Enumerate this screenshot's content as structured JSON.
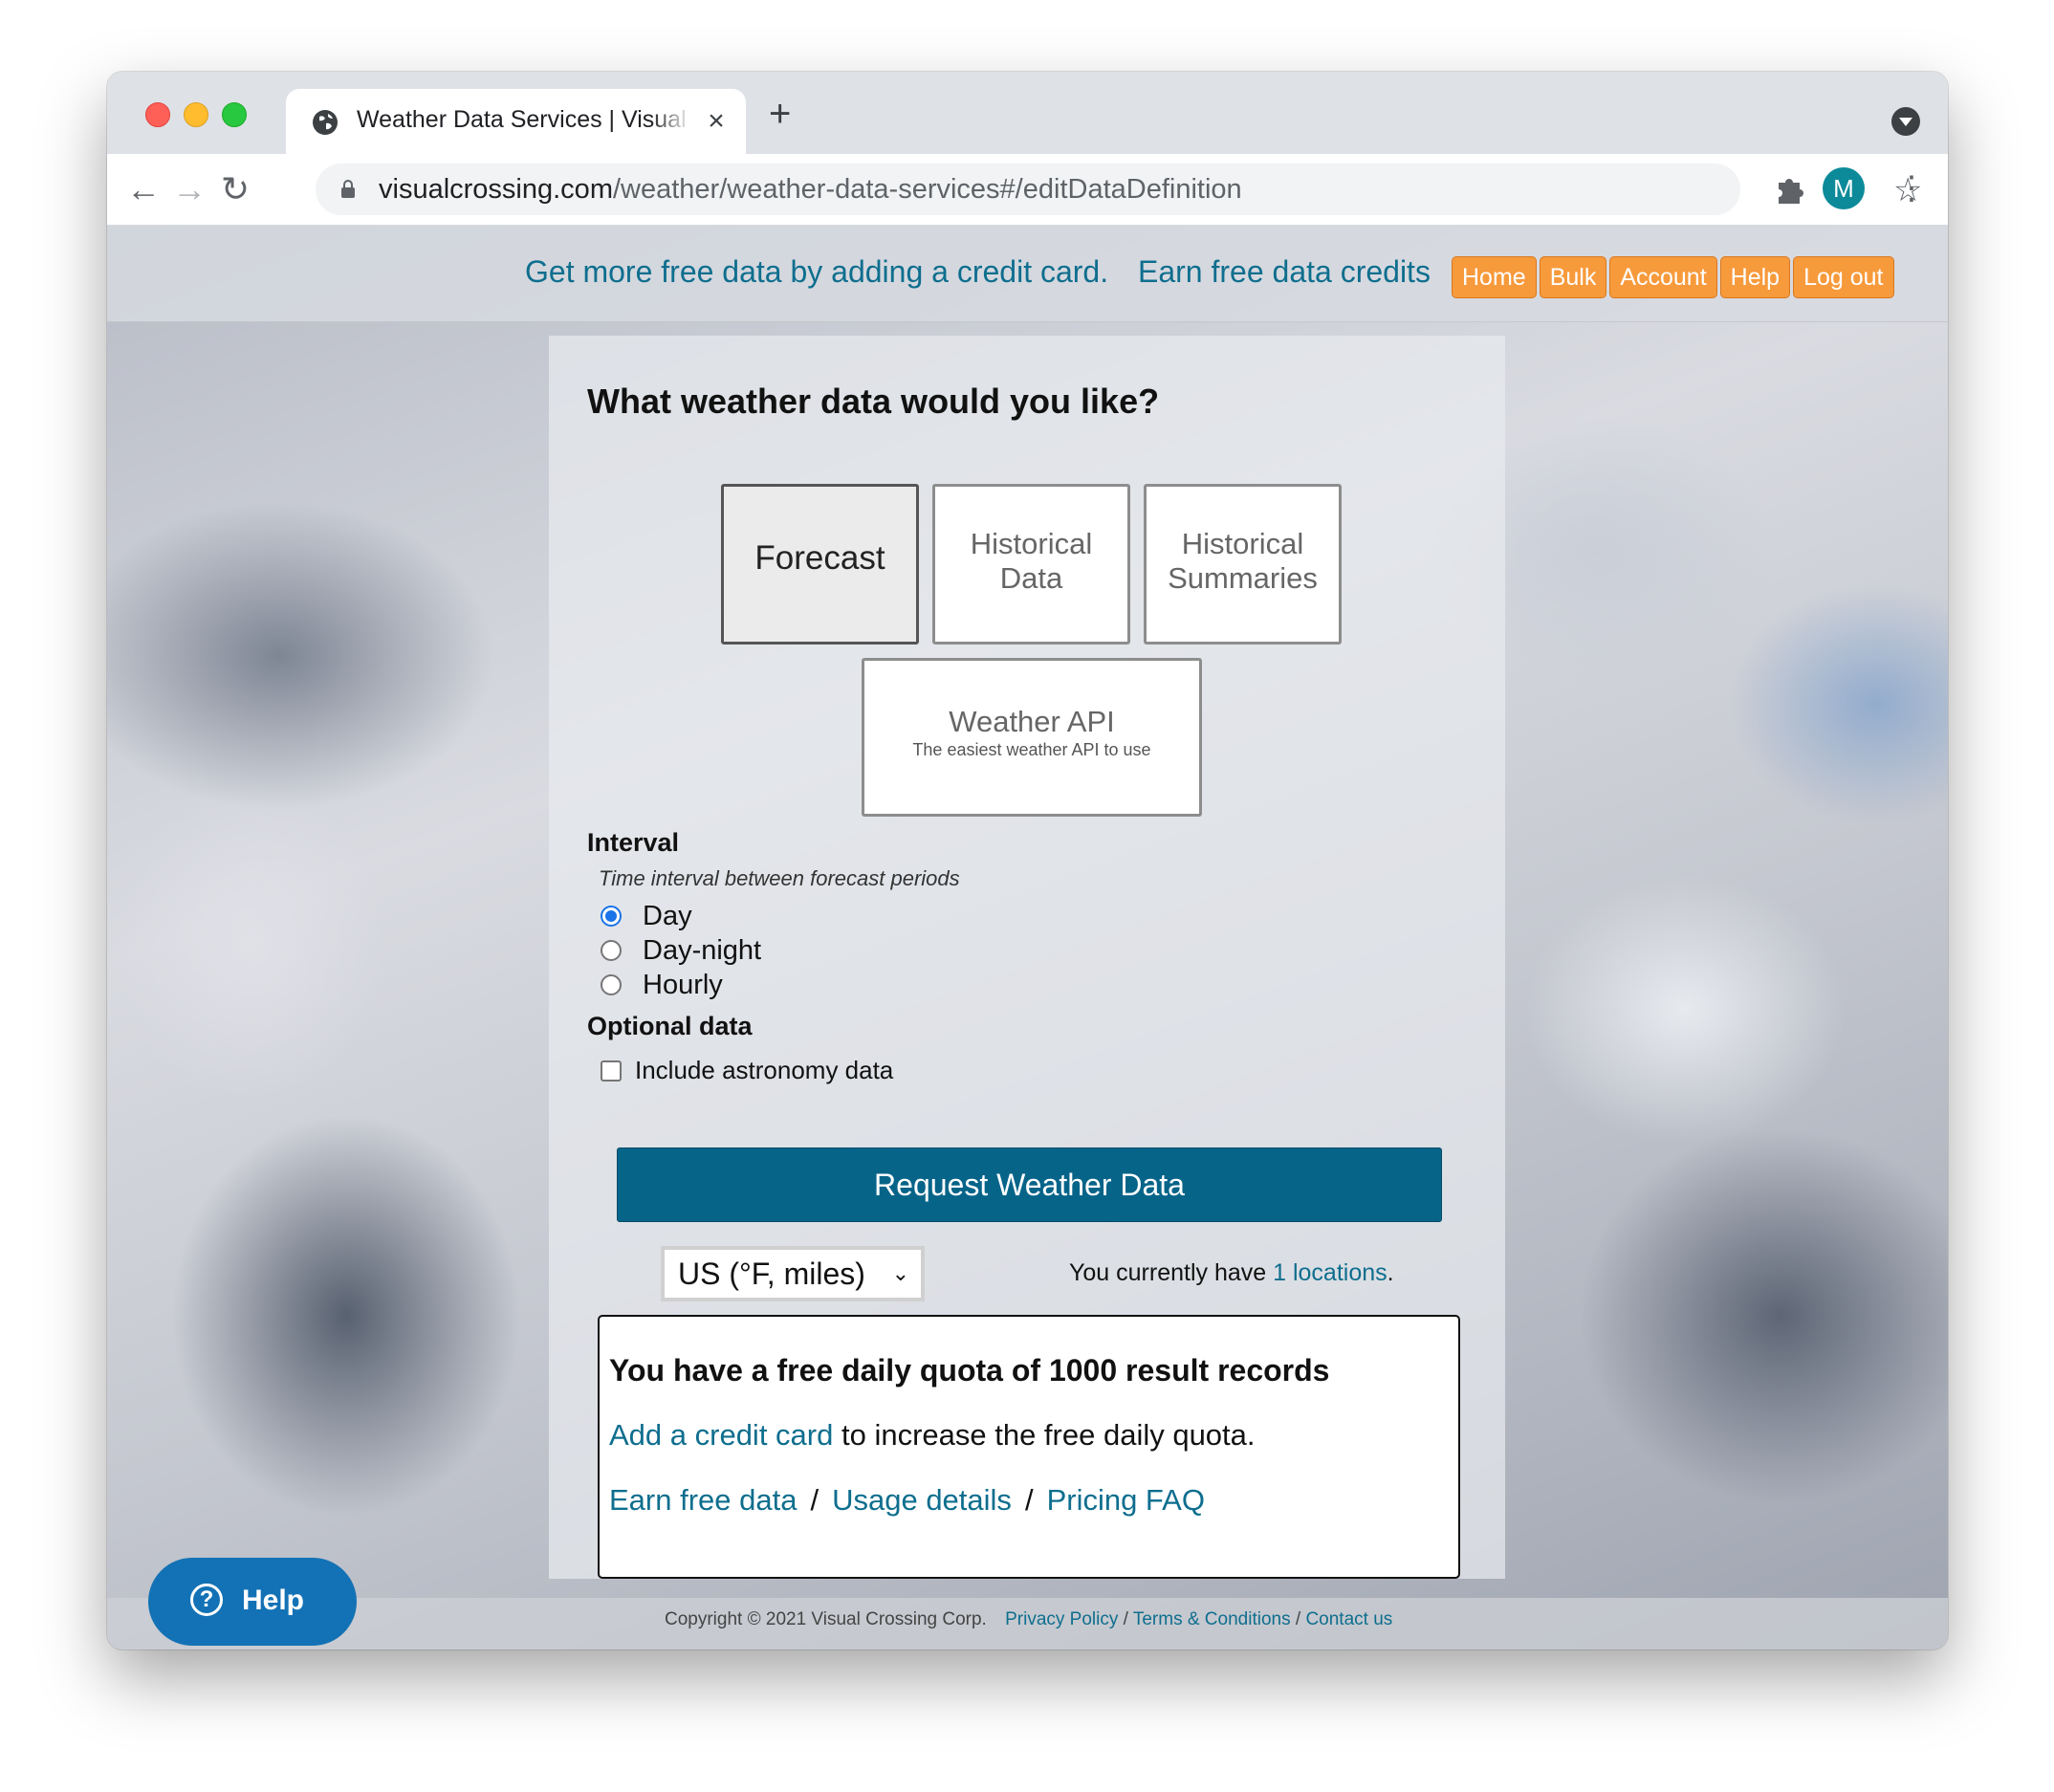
{
  "browser": {
    "tab_title": "Weather Data Services | Visual Crossing",
    "url_host": "visualcrossing.com",
    "url_path": "/weather/weather-data-services#/editDataDefinition",
    "profile_initial": "M"
  },
  "topbar": {
    "promo_credit_card": "Get more free data by adding a credit card.",
    "promo_earn": "Earn free data credits",
    "nav": [
      "Home",
      "Bulk",
      "Account",
      "Help",
      "Log out"
    ]
  },
  "panel": {
    "heading": "What weather data would you like?",
    "choices": {
      "forecast": "Forecast",
      "historical_data_1": "Historical",
      "historical_data_2": "Data",
      "historical_summaries_1": "Historical",
      "historical_summaries_2": "Summaries",
      "weather_api": "Weather API",
      "weather_api_sub": "The easiest weather API to use"
    },
    "interval": {
      "label": "Interval",
      "hint": "Time interval between forecast periods",
      "options": [
        "Day",
        "Day-night",
        "Hourly"
      ],
      "selected": "Day"
    },
    "optional": {
      "label": "Optional data",
      "astronomy": "Include astronomy data",
      "astronomy_checked": false
    },
    "request_button": "Request Weather Data",
    "units": "US (°F, miles)",
    "locations": {
      "prefix": "You currently have ",
      "link": "1 locations",
      "suffix": "."
    },
    "quota": {
      "title": "You have a free daily quota of 1000 result records",
      "add_card_link": "Add a credit card",
      "add_card_rest": " to increase the free daily quota.",
      "links": [
        "Earn free data",
        "Usage details",
        "Pricing FAQ"
      ],
      "separator": "/"
    }
  },
  "footer": {
    "copyright": "Copyright © 2021 Visual Crossing Corp.",
    "links": [
      "Privacy Policy",
      "Terms & Conditions",
      "Contact us"
    ],
    "separator": " / "
  },
  "help_widget": {
    "label": "Help"
  },
  "colors": {
    "accent_orange": "#f79a3c",
    "primary_button": "#076489",
    "link": "#0e6e8e",
    "help_button": "#1372b5"
  }
}
